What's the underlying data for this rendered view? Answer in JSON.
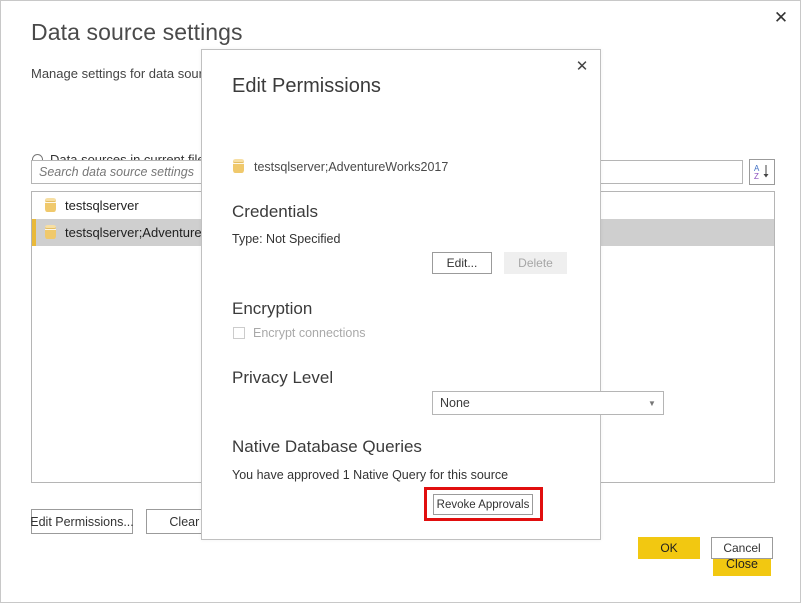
{
  "window": {
    "title": "Data source settings",
    "subtitle": "Manage settings for data sour",
    "close_icon": "close-icon",
    "close_glyph": "✕"
  },
  "scope": {
    "radio_label": "Data sources in current file",
    "selected": true
  },
  "search": {
    "placeholder": "Search data source settings",
    "value": "",
    "sort_icon": "sort-az-descending-icon",
    "sort_letter_top": "A",
    "sort_letter_bottom": "Z",
    "sort_top_color": "#3f6fc4",
    "sort_bottom_color": "#8a4fbe"
  },
  "source_list": {
    "items": [
      {
        "icon": "database-icon",
        "label": "testsqlserver",
        "selected": false
      },
      {
        "icon": "database-icon",
        "label": "testsqlserver;Adventure",
        "selected": true
      }
    ]
  },
  "footer": {
    "edit_permissions_label": "Edit Permissions...",
    "clear_permissions_label": "Clear Perm",
    "close_label": "Close"
  },
  "dialog": {
    "title": "Edit Permissions",
    "close_icon": "close-icon",
    "close_glyph": "✕",
    "source": {
      "icon": "database-icon",
      "label": "testsqlserver;AdventureWorks2017"
    },
    "credentials": {
      "heading": "Credentials",
      "type_text": "Type: Not Specified",
      "edit_label": "Edit...",
      "delete_label": "Delete",
      "delete_disabled": true
    },
    "encryption": {
      "heading": "Encryption",
      "checkbox_label": "Encrypt connections",
      "checked": false,
      "disabled": true
    },
    "privacy": {
      "heading": "Privacy Level",
      "selected_value": "None",
      "chevron_icon": "chevron-down-icon",
      "chevron_glyph": "▼"
    },
    "native_queries": {
      "heading": "Native Database Queries",
      "description": "You have approved 1 Native Query for this source",
      "revoke_label": "Revoke Approvals",
      "highlight_color": "#e10e0e"
    },
    "ok_label": "OK",
    "cancel_label": "Cancel"
  },
  "colors": {
    "accent_yellow": "#f2c811",
    "selection_gray": "#cfcfcf",
    "selection_bar": "#e9b93a",
    "highlight_red": "#e10e0e",
    "db_icon": "#f0c96c"
  }
}
